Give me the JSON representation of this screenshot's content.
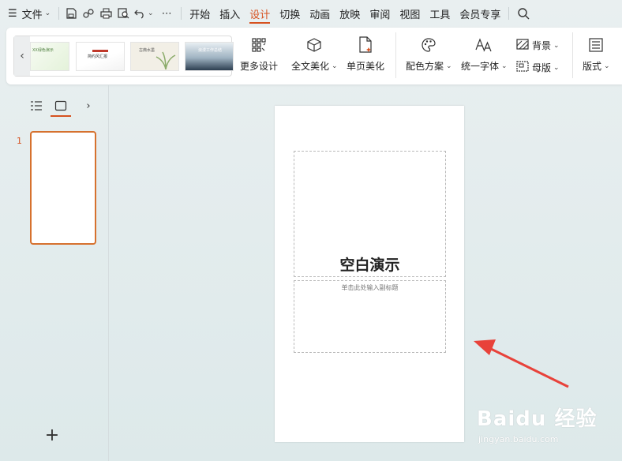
{
  "menubar": {
    "items": [
      "文件",
      "开始",
      "插入",
      "设计",
      "切换",
      "动画",
      "放映",
      "审阅",
      "视图",
      "工具",
      "会员专享"
    ],
    "active": "设计"
  },
  "ribbon": {
    "more_design": "更多设计",
    "full_beautify": "全文美化",
    "page_beautify": "单页美化",
    "color_scheme": "配色方案",
    "unify_font": "统一字体",
    "background": "背景",
    "master": "母版",
    "layout": "版式"
  },
  "thumbs": [
    {
      "text": "XX绿色演示",
      "accent": "#6aa84f"
    },
    {
      "text": "简约风汇报",
      "accent": "#c0392b"
    },
    {
      "text": "古典水墨",
      "accent": "#8bab6a"
    },
    {
      "text": "浪漫工作总结",
      "accent": "#2c3e50"
    }
  ],
  "slides_panel": {
    "slide_number": "1",
    "add_label": "+"
  },
  "slide": {
    "title": "空白演示",
    "subtitle": "单击此处输入副标题"
  },
  "watermark": {
    "brand": "Baidu 经验",
    "url": "jingyan.baidu.com"
  },
  "colors": {
    "accent": "#d6511f",
    "arrow": "#e8423a"
  }
}
